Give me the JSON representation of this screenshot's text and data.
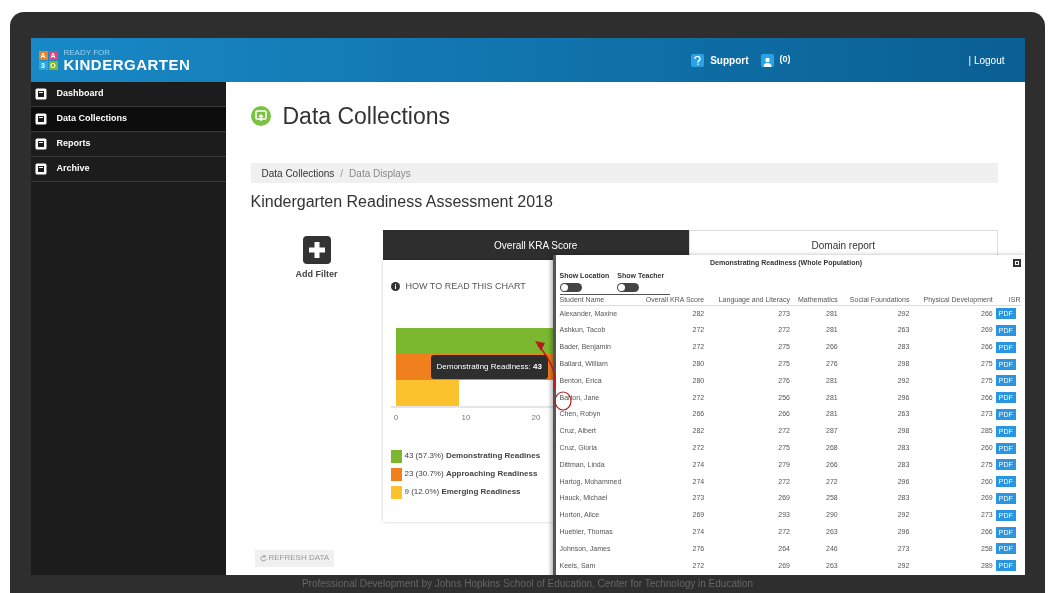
{
  "header": {
    "logo_small": "READY FOR",
    "logo_large": "KINDERGARTEN",
    "logo_tiles": [
      "A",
      "A",
      "3",
      "O"
    ],
    "support": "Support",
    "notifications": "(0)",
    "logout": "| Logout"
  },
  "sidebar": {
    "items": [
      {
        "label": "Dashboard",
        "selected": false
      },
      {
        "label": "Data Collections",
        "selected": true
      },
      {
        "label": "Reports",
        "selected": false
      },
      {
        "label": "Archive",
        "selected": false
      }
    ]
  },
  "page_title": "Data Collections",
  "breadcrumb": [
    "Data Collections",
    "Data Displays"
  ],
  "breadcrumb_separator": "/",
  "assessment_title": "Kindergarten Readiness Assessment 2018",
  "add_filter": "Add Filter",
  "refresh": "REFRESH DATA",
  "tabs": [
    {
      "label": "Overall KRA Score",
      "selected": true
    },
    {
      "label": "Domain report",
      "selected": false
    }
  ],
  "chart": {
    "info": "HOW TO READ THIS CHART",
    "tooltip_label": "Demonstrating Readiness: ",
    "tooltip_value": "43",
    "axis_ticks": [
      "0",
      "10",
      "20"
    ],
    "legend": [
      {
        "count": "43 (57.3%)",
        "label": "Demonstrating Readines",
        "color": "#7cb82f"
      },
      {
        "count": "23 (30.7%)",
        "label": "Approaching Readiness",
        "color": "#f07f1e"
      },
      {
        "count": "9 (12.0%)",
        "label": "Emerging Readiness",
        "color": "#fbc22d"
      }
    ]
  },
  "modal": {
    "title": "Demonstrating Readiness (Whole Population)",
    "toggles": [
      {
        "label": "Show Location",
        "on": false
      },
      {
        "label": "Show Teacher",
        "on": false
      }
    ],
    "columns": [
      "Student Name",
      "Overall KRA Score",
      "Language and Literacy",
      "Mathematics",
      "Social Foundations",
      "Physical Development",
      "ISR"
    ],
    "rows": [
      {
        "cells": [
          "Alexander, Maxine",
          "282",
          "273",
          "281",
          "292",
          "266"
        ],
        "button": "PDF"
      },
      {
        "cells": [
          "Ashkun, Tacob",
          "272",
          "272",
          "281",
          "263",
          "269"
        ],
        "button": "PDF"
      },
      {
        "cells": [
          "Bader, Benjamin",
          "272",
          "275",
          "266",
          "283",
          "266"
        ],
        "button": "PDF"
      },
      {
        "cells": [
          "Ballard, William",
          "280",
          "275",
          "276",
          "298",
          "275"
        ],
        "button": "PDF"
      },
      {
        "cells": [
          "Benton, Erica",
          "280",
          "276",
          "281",
          "292",
          "275"
        ],
        "button": "PDF"
      },
      {
        "cells": [
          "Barton, Jane",
          "272",
          "256",
          "281",
          "296",
          "266"
        ],
        "button": "PDF"
      },
      {
        "cells": [
          "Chen, Robyn",
          "266",
          "266",
          "281",
          "263",
          "273"
        ],
        "button": "PDF"
      },
      {
        "cells": [
          "Cruz, Albert",
          "282",
          "272",
          "287",
          "298",
          "285"
        ],
        "button": "PDF"
      },
      {
        "cells": [
          "Cruz, Gloria",
          "272",
          "275",
          "268",
          "283",
          "260"
        ],
        "button": "PDF"
      },
      {
        "cells": [
          "Dittman, Linda",
          "274",
          "279",
          "266",
          "283",
          "275"
        ],
        "button": "PDF"
      },
      {
        "cells": [
          "Hartog, Mohammed",
          "274",
          "272",
          "272",
          "296",
          "260"
        ],
        "button": "PDF"
      },
      {
        "cells": [
          "Hauck, Michael",
          "273",
          "269",
          "258",
          "283",
          "269"
        ],
        "button": "PDF"
      },
      {
        "cells": [
          "Horton, Alice",
          "269",
          "293",
          "290",
          "292",
          "273"
        ],
        "button": "PDF"
      },
      {
        "cells": [
          "Huebler, Thomas",
          "274",
          "272",
          "263",
          "296",
          "266"
        ],
        "button": "PDF"
      },
      {
        "cells": [
          "Johnson, James",
          "276",
          "264",
          "246",
          "273",
          "258"
        ],
        "button": "PDF"
      },
      {
        "cells": [
          "Keels, Sam",
          "272",
          "269",
          "263",
          "292",
          "289"
        ],
        "button": "PDF"
      }
    ]
  },
  "footer": "Professional Development by Johns Hopkins School of Education, Center for Technology in Education"
}
